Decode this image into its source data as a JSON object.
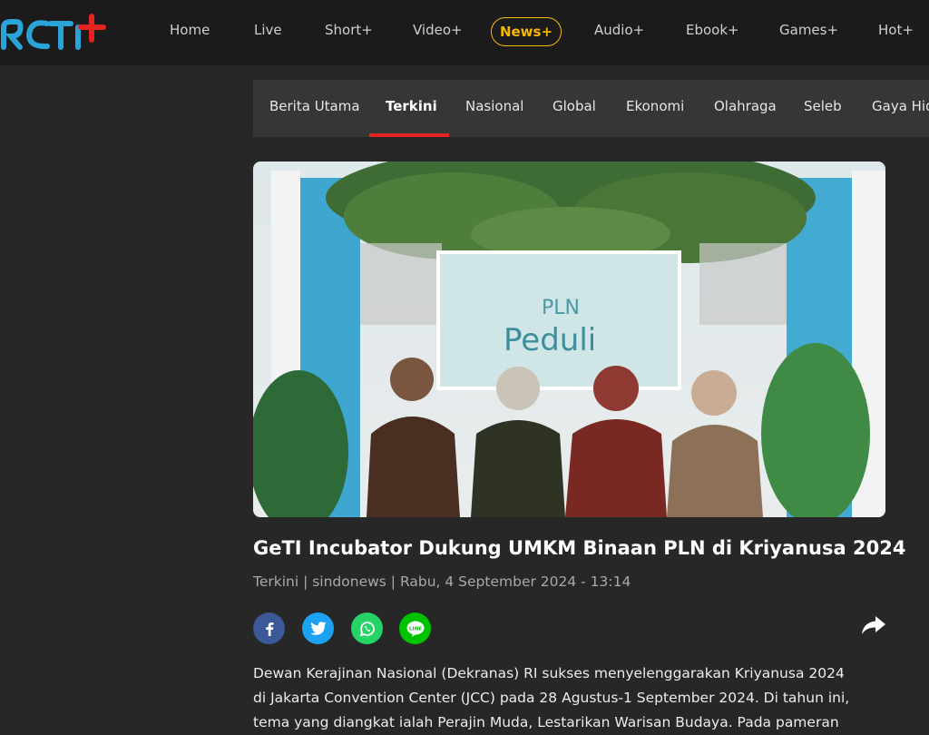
{
  "header": {
    "logo_text": "RCTI+",
    "nav": [
      {
        "label": "Home"
      },
      {
        "label": "Live"
      },
      {
        "label": "Short+"
      },
      {
        "label": "Video+"
      },
      {
        "label": "News+"
      },
      {
        "label": "Audio+"
      },
      {
        "label": "Ebook+"
      },
      {
        "label": "Games+"
      },
      {
        "label": "Hot+"
      }
    ],
    "active_index": 4,
    "accent_color": "#f5b700"
  },
  "subnav": {
    "items": [
      {
        "label": "Berita Utama"
      },
      {
        "label": "Terkini"
      },
      {
        "label": "Nasional"
      },
      {
        "label": "Global"
      },
      {
        "label": "Ekonomi"
      },
      {
        "label": "Olahraga"
      },
      {
        "label": "Seleb"
      },
      {
        "label": "Gaya Hidup"
      }
    ],
    "active_index": 1,
    "indicator_color": "#e5231f"
  },
  "article": {
    "image_sign_top": "PLN",
    "image_sign_bottom": "Peduli",
    "title": "GeTI Incubator Dukung UMKM Binaan PLN di Kriyanusa 2024",
    "meta": "Terkini | sindonews | Rabu, 4 September 2024 - 13:14",
    "body_lines": [
      "Dewan Kerajinan Nasional (Dekranas) RI sukses menyelenggarakan Kriyanusa 2024",
      "di Jakarta Convention Center (JCC) pada 28 Agustus-1 September 2024. Di tahun ini,",
      "tema yang diangkat ialah Perajin Muda, Lestarikan Warisan Budaya. Pada pameran"
    ]
  },
  "share": {
    "buttons": [
      {
        "icon": "facebook-icon",
        "color": "#3b5998"
      },
      {
        "icon": "twitter-icon",
        "color": "#1da1f2"
      },
      {
        "icon": "whatsapp-icon",
        "color": "#25d366"
      },
      {
        "icon": "line-icon",
        "color": "#00c300"
      }
    ],
    "more_icon": "share-arrow-icon"
  }
}
